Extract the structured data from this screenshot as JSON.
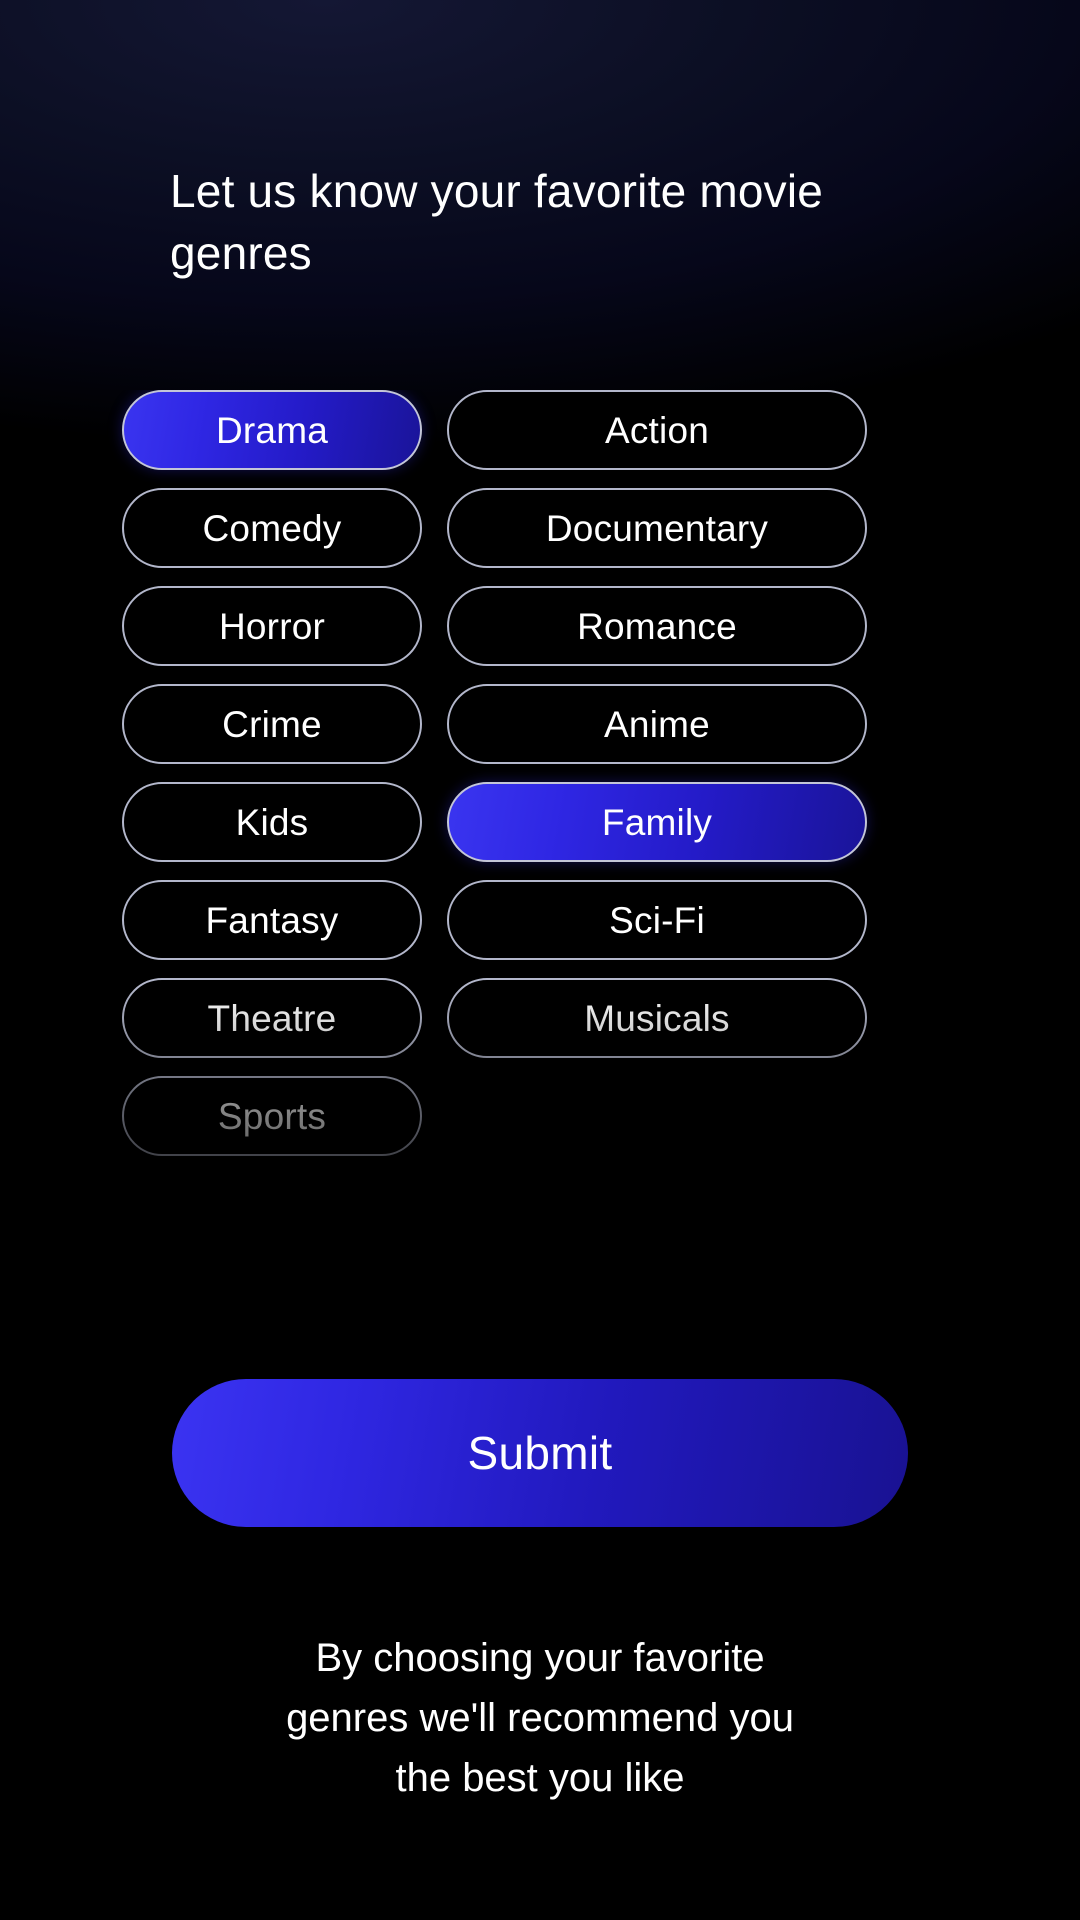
{
  "theme": {
    "background": "#000000",
    "top_glow": "#141734",
    "accent_blue_light": "#3a35f0",
    "accent_blue_dark": "#1a1499",
    "chip_border": "#b3b7cb",
    "text_primary": "#ffffff"
  },
  "header": {
    "title": "Let us know your favorite movie genres"
  },
  "genres": {
    "items": [
      {
        "label": "Drama",
        "selected": true,
        "column": "left",
        "dim": 1
      },
      {
        "label": "Action",
        "selected": false,
        "column": "right",
        "dim": 1
      },
      {
        "label": "Comedy",
        "selected": false,
        "column": "left",
        "dim": 1
      },
      {
        "label": "Documentary",
        "selected": false,
        "column": "right",
        "dim": 1
      },
      {
        "label": "Horror",
        "selected": false,
        "column": "left",
        "dim": 1
      },
      {
        "label": "Romance",
        "selected": false,
        "column": "right",
        "dim": 1
      },
      {
        "label": "Crime",
        "selected": false,
        "column": "left",
        "dim": 1
      },
      {
        "label": "Anime",
        "selected": false,
        "column": "right",
        "dim": 1
      },
      {
        "label": "Kids",
        "selected": false,
        "column": "left",
        "dim": 1
      },
      {
        "label": "Family",
        "selected": true,
        "column": "right",
        "dim": 1
      },
      {
        "label": "Fantasy",
        "selected": false,
        "column": "left",
        "dim": 1
      },
      {
        "label": "Sci-Fi",
        "selected": false,
        "column": "right",
        "dim": 1
      },
      {
        "label": "Theatre",
        "selected": false,
        "column": "left",
        "dim": 1
      },
      {
        "label": "Musicals",
        "selected": false,
        "column": "right",
        "dim": 1
      },
      {
        "label": "Sports",
        "selected": false,
        "column": "left",
        "dim": 1
      }
    ],
    "selected_labels": [
      "Drama",
      "Family"
    ],
    "selected_count": 2
  },
  "actions": {
    "submit_label": "Submit"
  },
  "footer": {
    "note": "By choosing your favorite\ngenres we'll recommend you\nthe best you like"
  }
}
